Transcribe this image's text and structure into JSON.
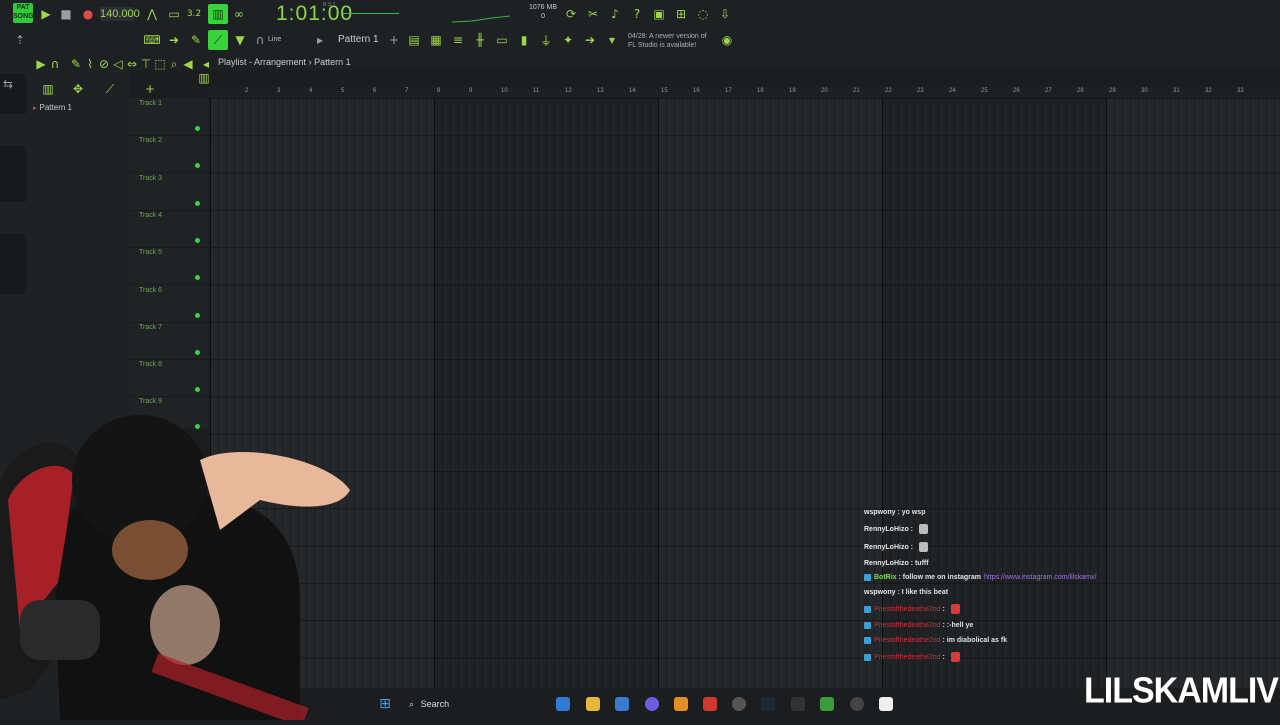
{
  "toolbar": {
    "pat_song_badge": "PAT\nSONG",
    "tempo": "140.000",
    "time": "1:01:00",
    "time_unit": "B:S:T",
    "memory": "1076 MB",
    "memory_sub": "0",
    "line_mode": "Line",
    "pattern_select": "Pattern 1",
    "notice_line1": "04/28: A newer version of",
    "notice_line2": "FL Studio is available!"
  },
  "browser": {
    "pattern_item": "Pattern 1"
  },
  "playlist": {
    "title": "Playlist - Arrangement",
    "separator": "›",
    "pattern": "Pattern 1",
    "ruler": [
      "2",
      "3",
      "4",
      "5",
      "6",
      "7",
      "8",
      "9",
      "10",
      "11",
      "12",
      "13",
      "14",
      "15",
      "16",
      "17",
      "18",
      "19",
      "20",
      "21",
      "22",
      "23",
      "24",
      "25",
      "26",
      "27",
      "28",
      "29",
      "30",
      "31",
      "32",
      "33"
    ],
    "tracks": [
      "Track 1",
      "Track 2",
      "Track 3",
      "Track 4",
      "Track 5",
      "Track 6",
      "Track 7",
      "Track 8",
      "Track 9"
    ]
  },
  "chat": {
    "messages": [
      {
        "user": "wspwony",
        "sep": " : ",
        "text": "yo wsp",
        "style": "white"
      },
      {
        "user": "RennyLoHizo",
        "sep": " : ",
        "text": "",
        "style": "white",
        "emote": true
      },
      {
        "user": "RennyLoHizo",
        "sep": " : ",
        "text": "",
        "style": "white",
        "emote": true
      },
      {
        "user": "RennyLoHizo",
        "sep": " : ",
        "text": "tufff",
        "style": "white"
      },
      {
        "user": "BotRix",
        "sep": " : ",
        "text": "follow me on instagram",
        "link": "https://www.instagram.com/lilskamx/",
        "style": "green",
        "badge": true
      },
      {
        "user": "wspwony",
        "sep": " : ",
        "text": "I like this beat",
        "style": "white"
      },
      {
        "user": "Priestofthedeathe2nd",
        "sep": " : ",
        "text": "",
        "style": "red",
        "badge": true,
        "emote": true
      },
      {
        "user": "Priestofthedeathe2nd",
        "sep": " : ",
        "text": ":-hell ye",
        "style": "red",
        "badge": true
      },
      {
        "user": "Priestofthedeathe2nd",
        "sep": " : ",
        "text": "im diabolical as fk",
        "style": "red",
        "badge": true
      },
      {
        "user": "Priestofthedeathe2nd",
        "sep": " : ",
        "text": "",
        "style": "red",
        "badge": true,
        "emote": true
      }
    ]
  },
  "taskbar": {
    "search_label": "Search"
  },
  "watermark": "LILSKAMLIVE",
  "colors": {
    "accent_green": "#3dcf47",
    "time_green": "#8fd446",
    "chat_red": "#d02d3a",
    "chat_link": "#9d75e6"
  }
}
